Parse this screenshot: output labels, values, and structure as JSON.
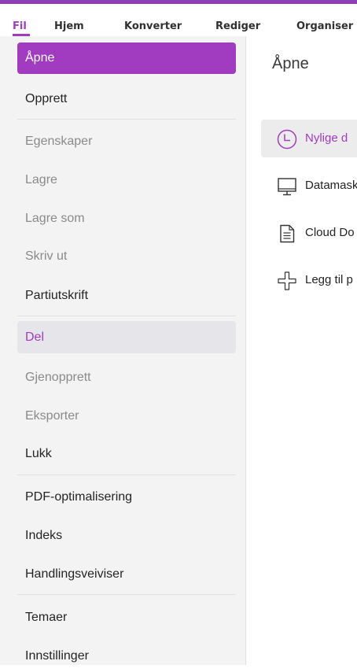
{
  "menubar": {
    "items": [
      "Fil",
      "Hjem",
      "Konverter",
      "Rediger",
      "Organiser"
    ]
  },
  "sidebar": {
    "items": [
      {
        "label": "Åpne",
        "state": "selected"
      },
      {
        "label": "Opprett",
        "state": "normal"
      },
      {
        "label": "Egenskaper",
        "state": "disabled"
      },
      {
        "label": "Lagre",
        "state": "disabled"
      },
      {
        "label": "Lagre som",
        "state": "disabled"
      },
      {
        "label": "Skriv ut",
        "state": "disabled"
      },
      {
        "label": "Partiutskrift",
        "state": "normal"
      },
      {
        "label": "Del",
        "state": "hover"
      },
      {
        "label": "Gjenopprett",
        "state": "disabled"
      },
      {
        "label": "Eksporter",
        "state": "disabled"
      },
      {
        "label": "Lukk",
        "state": "normal"
      },
      {
        "label": "PDF-optimalisering",
        "state": "normal"
      },
      {
        "label": "Indeks",
        "state": "normal"
      },
      {
        "label": "Handlingsveiviser",
        "state": "normal"
      },
      {
        "label": "Temaer",
        "state": "normal"
      },
      {
        "label": "Innstillinger",
        "state": "normal"
      }
    ]
  },
  "panel": {
    "title": "Åpne",
    "options": [
      {
        "label": "Nylige d",
        "icon": "clock-icon",
        "active": true
      },
      {
        "label": "Datamask",
        "icon": "monitor-icon",
        "active": false
      },
      {
        "label": "Cloud Do",
        "icon": "document-icon",
        "active": false
      },
      {
        "label": "Legg til p",
        "icon": "plus-icon",
        "active": false
      }
    ]
  },
  "colors": {
    "accent": "#a13bc0",
    "topbar": "#8e3fb8",
    "sidebar_bg": "#f3f3f3"
  }
}
